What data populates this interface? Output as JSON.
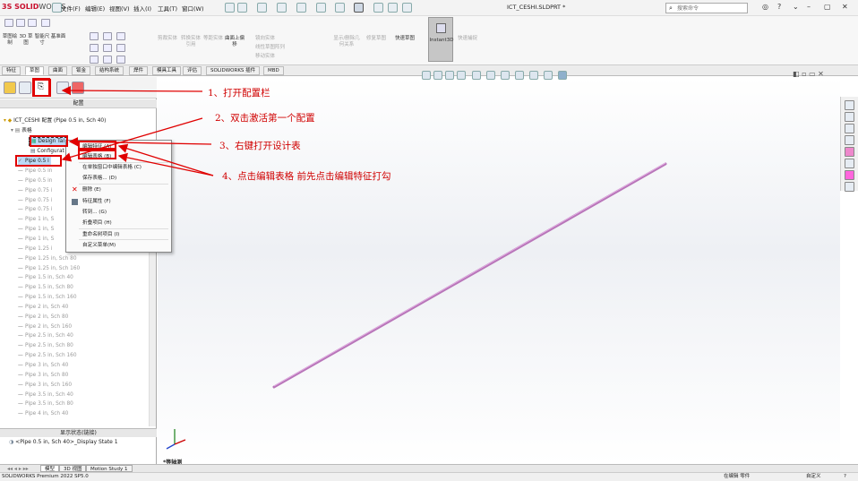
{
  "titlebar": {
    "logo_brand": "SOLID",
    "logo_rest": "WORKS",
    "menus": [
      "文件(F)",
      "编辑(E)",
      "视图(V)",
      "插入(I)",
      "工具(T)",
      "窗口(W)"
    ],
    "document_title": "ICT_CESHI.SLDPRT *",
    "search_placeholder": "搜索命令"
  },
  "commandmanager": {
    "sketch_buttons": [
      "草图绘制",
      "3D 草图",
      "智能尺寸",
      "基准面"
    ],
    "gray_buttons": [
      "剪裁实体",
      "转换实体引用",
      "等距实体",
      "曲面上偏移",
      "镜向实体",
      "线性草图阵列",
      "移动实体",
      "显示/删除几何关系",
      "修复草图"
    ],
    "gray_line1": [
      "镜向实体",
      "线性草图阵列",
      "移动实体"
    ],
    "quick_snaps": "快速草图",
    "instant3d": "Instant3D",
    "rapid_sketch": "快速捕捉"
  },
  "tabs": [
    "特征",
    "草图",
    "曲面",
    "钣金",
    "结构系统",
    "焊件",
    "模具工具",
    "评估",
    "SOLIDWORKS 插件",
    "MBD"
  ],
  "active_tab_index": 1,
  "left_panel": {
    "header": "配置",
    "root": "ICT_CESHI 配置  (Pipe 0.5 in, Sch 40)",
    "table_folder": "表格",
    "design_table": "Design Tal",
    "configurations": "Configurat",
    "active_config": "Pipe 0.5 i",
    "configs": [
      "Pipe 0.5 in",
      "Pipe 0.5 in",
      "Pipe 0.75 i",
      "Pipe 0.75 i",
      "Pipe 0.75 i",
      "Pipe 1 in, S",
      "Pipe 1 in, S",
      "Pipe 1 in, S",
      "Pipe 1.25 i",
      "Pipe 1.25 in, Sch 80",
      "Pipe 1.25 in, Sch 160",
      "Pipe 1.5 in, Sch 40",
      "Pipe 1.5 in, Sch 80",
      "Pipe 1.5 in, Sch 160",
      "Pipe 2 in, Sch 40",
      "Pipe 2 in, Sch 80",
      "Pipe 2 in, Sch 160",
      "Pipe 2.5 in, Sch 40",
      "Pipe 2.5 in, Sch 80",
      "Pipe 2.5 in, Sch 160",
      "Pipe 3 in, Sch 40",
      "Pipe 3 in, Sch 80",
      "Pipe 3 in, Sch 160",
      "Pipe 3.5 in, Sch 40",
      "Pipe 3.5 in, Sch 80",
      "Pipe 4 in, Sch 40"
    ],
    "display_state_header": "显示状态(链接)",
    "display_state": "<Pipe 0.5 in, Sch 40>_Display State 1"
  },
  "context_menu": {
    "items": [
      "编辑特征 (A)",
      "编辑表格 (B)",
      "在单独窗口中编辑表格 (C)",
      "保存表格... (D)",
      "删除 (E)",
      "特征属性 (F)",
      "转到... (G)",
      "折叠项目 (H)",
      "重命名树项目 (I)",
      "自定义菜单(M)"
    ]
  },
  "annotations": {
    "step1": "1、打开配置栏",
    "step2": "2、双击激活第一个配置",
    "step3": "3、右键打开设计表",
    "step4": "4、点击编辑表格 前先点击编辑特征打勾"
  },
  "graphics": {
    "view_label": "*等轴测",
    "part_color": "#c77dc8"
  },
  "bottom_tabs": [
    "模型",
    "3D 视图",
    "Motion Study 1"
  ],
  "status": {
    "app": "SOLIDWORKS Premium 2022 SP5.0",
    "mode": "在编辑 零件",
    "custom": "自定义"
  }
}
